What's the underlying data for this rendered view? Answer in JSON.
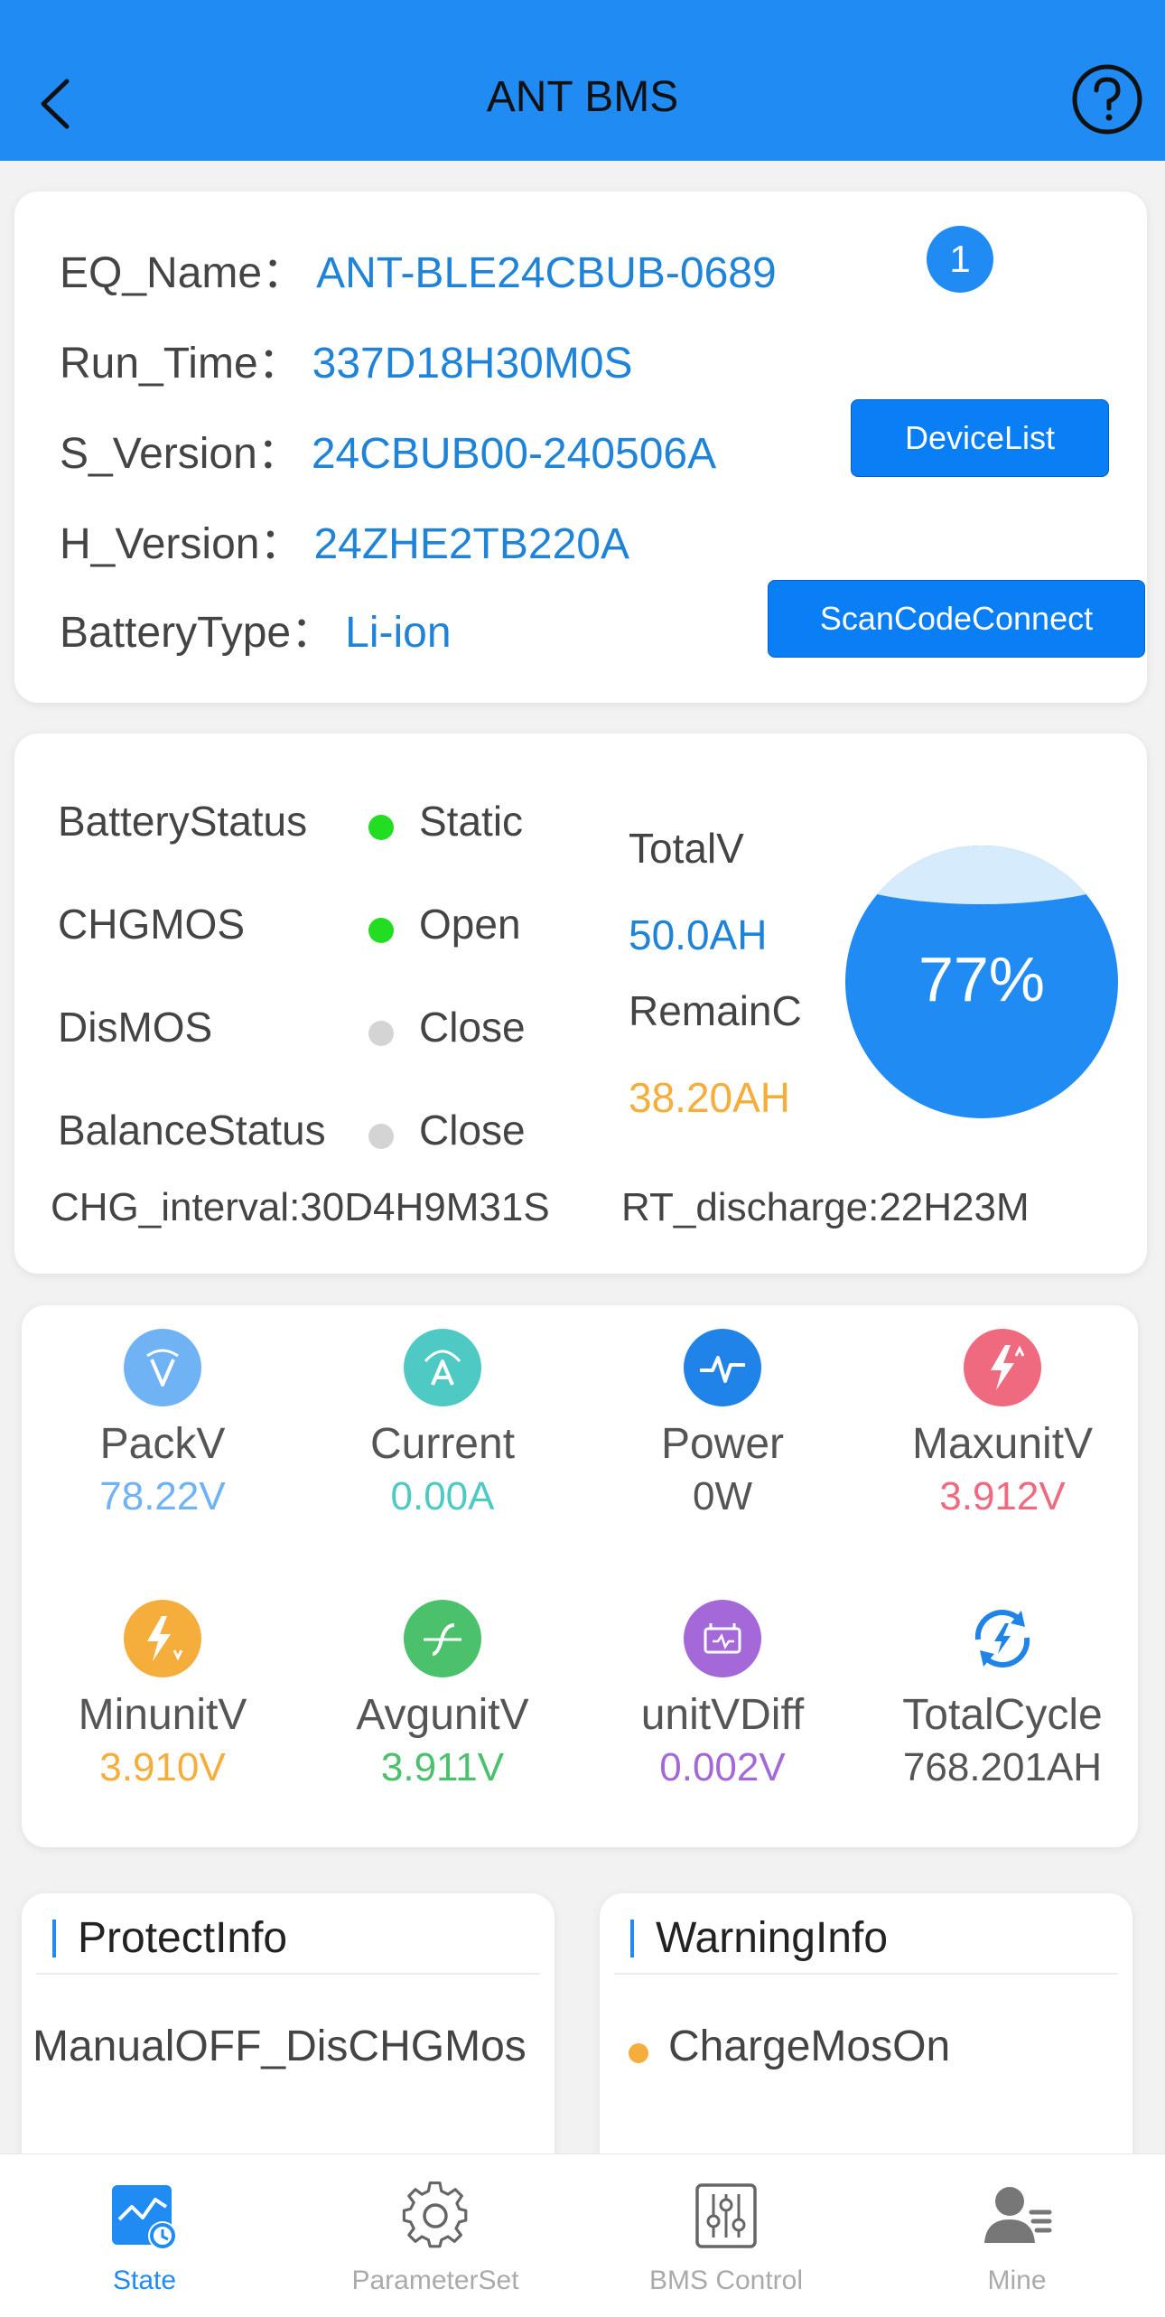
{
  "header": {
    "title": "ANT BMS"
  },
  "device": {
    "eq_name_label": "EQ_Name：",
    "eq_name_value": "ANT-BLE24CBUB-0689",
    "badge": "1",
    "run_time_label": "Run_Time：",
    "run_time_value": "337D18H30M0S",
    "s_version_label": "S_Version：",
    "s_version_value": "24CBUB00-240506A",
    "h_version_label": "H_Version：",
    "h_version_value": "24ZHE2TB220A",
    "battery_type_label": "BatteryType：",
    "battery_type_value": "Li-ion",
    "device_list_button": "DeviceList",
    "scan_connect_button": "ScanCodeConnect"
  },
  "status": {
    "battery_status_label": "BatteryStatus",
    "battery_status_value": "Static",
    "chgmos_label": "CHGMOS",
    "chgmos_value": "Open",
    "dismos_label": "DisMOS",
    "dismos_value": "Close",
    "balance_label": "BalanceStatus",
    "balance_value": "Close",
    "total_v_label": "TotalV",
    "total_v_value": "50.0AH",
    "remain_c_label": "RemainC",
    "remain_c_value": "38.20AH",
    "soc": "77%",
    "chg_interval": "CHG_interval:30D4H9M31S",
    "rt_discharge": "RT_discharge:22H23M",
    "colors": {
      "on": "#22dd22",
      "off": "#d4d4d4"
    }
  },
  "metrics": [
    {
      "label": "PackV",
      "value": "78.22V",
      "icon": "volt-icon",
      "color": "#6fb3f5"
    },
    {
      "label": "Current",
      "value": "0.00A",
      "icon": "ampere-icon",
      "color": "#4fc9c3"
    },
    {
      "label": "Power",
      "value": "0W",
      "icon": "power-icon",
      "color": "#1f83e8"
    },
    {
      "label": "MaxunitV",
      "value": "3.912V",
      "icon": "max-voltage-icon",
      "color": "#ef6a7e"
    },
    {
      "label": "MinunitV",
      "value": "3.910V",
      "icon": "min-voltage-icon",
      "color": "#f5ad3b"
    },
    {
      "label": "AvgunitV",
      "value": "3.911V",
      "icon": "avg-voltage-icon",
      "color": "#4cc16b"
    },
    {
      "label": "unitVDiff",
      "value": "0.002V",
      "icon": "voltage-diff-icon",
      "color": "#a468d8"
    },
    {
      "label": "TotalCycle",
      "value": "768.201AH",
      "icon": "cycle-icon",
      "color": "#1f83e8"
    }
  ],
  "protect": {
    "title": "ProtectInfo",
    "item": "ManualOFF_DisCHGMos"
  },
  "warning": {
    "title": "WarningInfo",
    "item": "ChargeMosOn",
    "dot_color": "#f5ad3b"
  },
  "tabs": [
    {
      "label": "State",
      "icon": "state-chart-icon"
    },
    {
      "label": "ParameterSet",
      "icon": "gear-icon"
    },
    {
      "label": "BMS Control",
      "icon": "sliders-icon"
    },
    {
      "label": "Mine",
      "icon": "user-icon"
    }
  ]
}
